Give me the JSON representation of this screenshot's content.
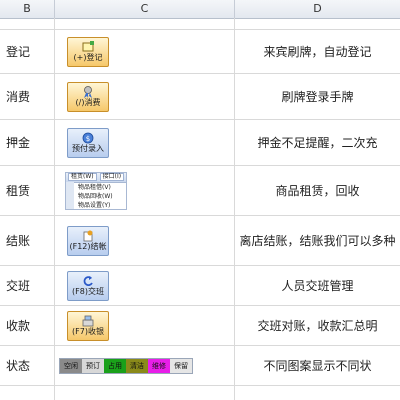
{
  "columns": {
    "b": "B",
    "c": "C",
    "d": "D"
  },
  "rows": [
    {
      "name": "登记",
      "button": "(+)登记",
      "icon": "register-card-icon",
      "hot": true,
      "desc": "来宾刷牌，自动登记"
    },
    {
      "name": "消费",
      "button": "(/)消费",
      "icon": "award-ribbon-icon",
      "hot": true,
      "desc": "刷牌登录手牌"
    },
    {
      "name": "押金",
      "button": "预付录入",
      "icon": "deposit-coin-icon",
      "hot": false,
      "desc": "押金不足提醒，二次充"
    },
    {
      "name": "租赁",
      "button": "",
      "icon": "",
      "hot": false,
      "desc": "商品租赁，回收"
    },
    {
      "name": "结账",
      "button": "(F12)结帐",
      "icon": "checkout-icon",
      "hot": false,
      "desc": "离店结账，结账我们可以多种"
    },
    {
      "name": "交班",
      "button": "(F8)交班",
      "icon": "shift-arrow-icon",
      "hot": false,
      "desc": "人员交班管理"
    },
    {
      "name": "收款",
      "button": "(F7)收银",
      "icon": "cash-register-icon",
      "hot": true,
      "desc": "交班对账，收款汇总明"
    },
    {
      "name": "状态",
      "button": "",
      "icon": "",
      "hot": false,
      "desc": "不同图案显示不同状"
    }
  ],
  "rental_menu": {
    "tabs": [
      "租赁(W)",
      "接口(I)"
    ],
    "items": [
      "物品租借(V)",
      "物品回收(W)",
      "物品设置(Y)"
    ]
  },
  "status_bar": [
    {
      "label": "空闲",
      "color": "#8a8a8a"
    },
    {
      "label": "预订",
      "color": "#d8d8d8"
    },
    {
      "label": "占用",
      "color": "#1aa01a"
    },
    {
      "label": "清洁",
      "color": "#8a8a1a"
    },
    {
      "label": "维修",
      "color": "#e81ee8"
    },
    {
      "label": "保留",
      "color": "#e6e6e6"
    }
  ]
}
